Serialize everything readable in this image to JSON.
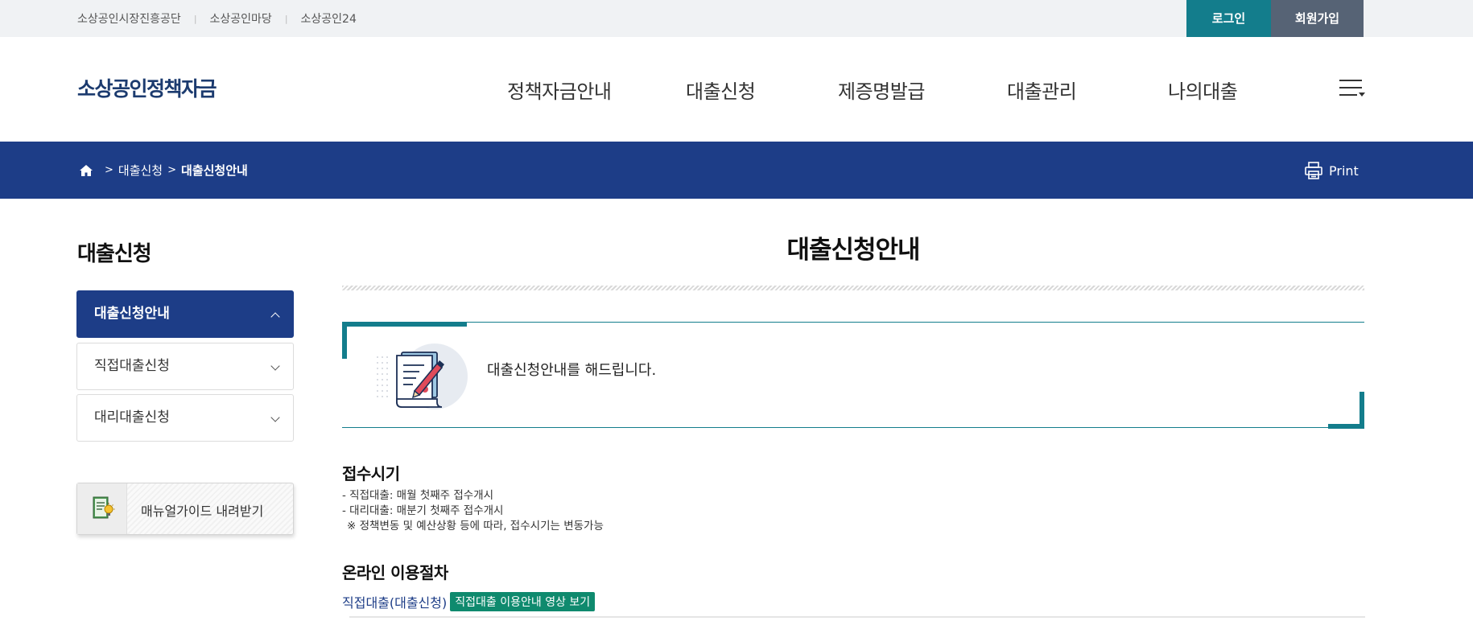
{
  "util_bar": {
    "links": [
      "소상공인시장진흥공단",
      "소상공인마당",
      "소상공인24"
    ],
    "login_label": "로그인",
    "join_label": "회원가입"
  },
  "header": {
    "logo": "소상공인정책자금",
    "nav": [
      "정책자금안내",
      "대출신청",
      "제증명발급",
      "대출관리",
      "나의대출"
    ]
  },
  "location": {
    "breadcrumb": [
      "대출신청",
      "대출신청안내"
    ],
    "print_label": "Print"
  },
  "sidebar": {
    "title": "대출신청",
    "items": [
      {
        "label": "대출신청안내",
        "active": true
      },
      {
        "label": "직접대출신청",
        "active": false
      },
      {
        "label": "대리대출신청",
        "active": false
      }
    ],
    "manual_label": "매뉴얼가이드 내려받기"
  },
  "main": {
    "page_title": "대출신청안내",
    "intro_text": "대출신청안내를 해드립니다.",
    "section1": {
      "title": "접수시기",
      "lines": [
        "- 직접대출: 매월 첫째주 접수개시",
        "- 대리대출: 매분기 첫째주 접수개시",
        "※ 정책변동 및 예산상황 등에 따라, 접수시기는 변동가능"
      ]
    },
    "section2": {
      "title": "온라인 이용절차",
      "link_label": "직접대출(대출신청)",
      "video_badge": "직접대출 이용안내 영상 보기"
    }
  },
  "colors": {
    "navy": "#1d3d87",
    "teal": "#137d8c",
    "slate": "#566375",
    "green": "#0f8a6e"
  }
}
